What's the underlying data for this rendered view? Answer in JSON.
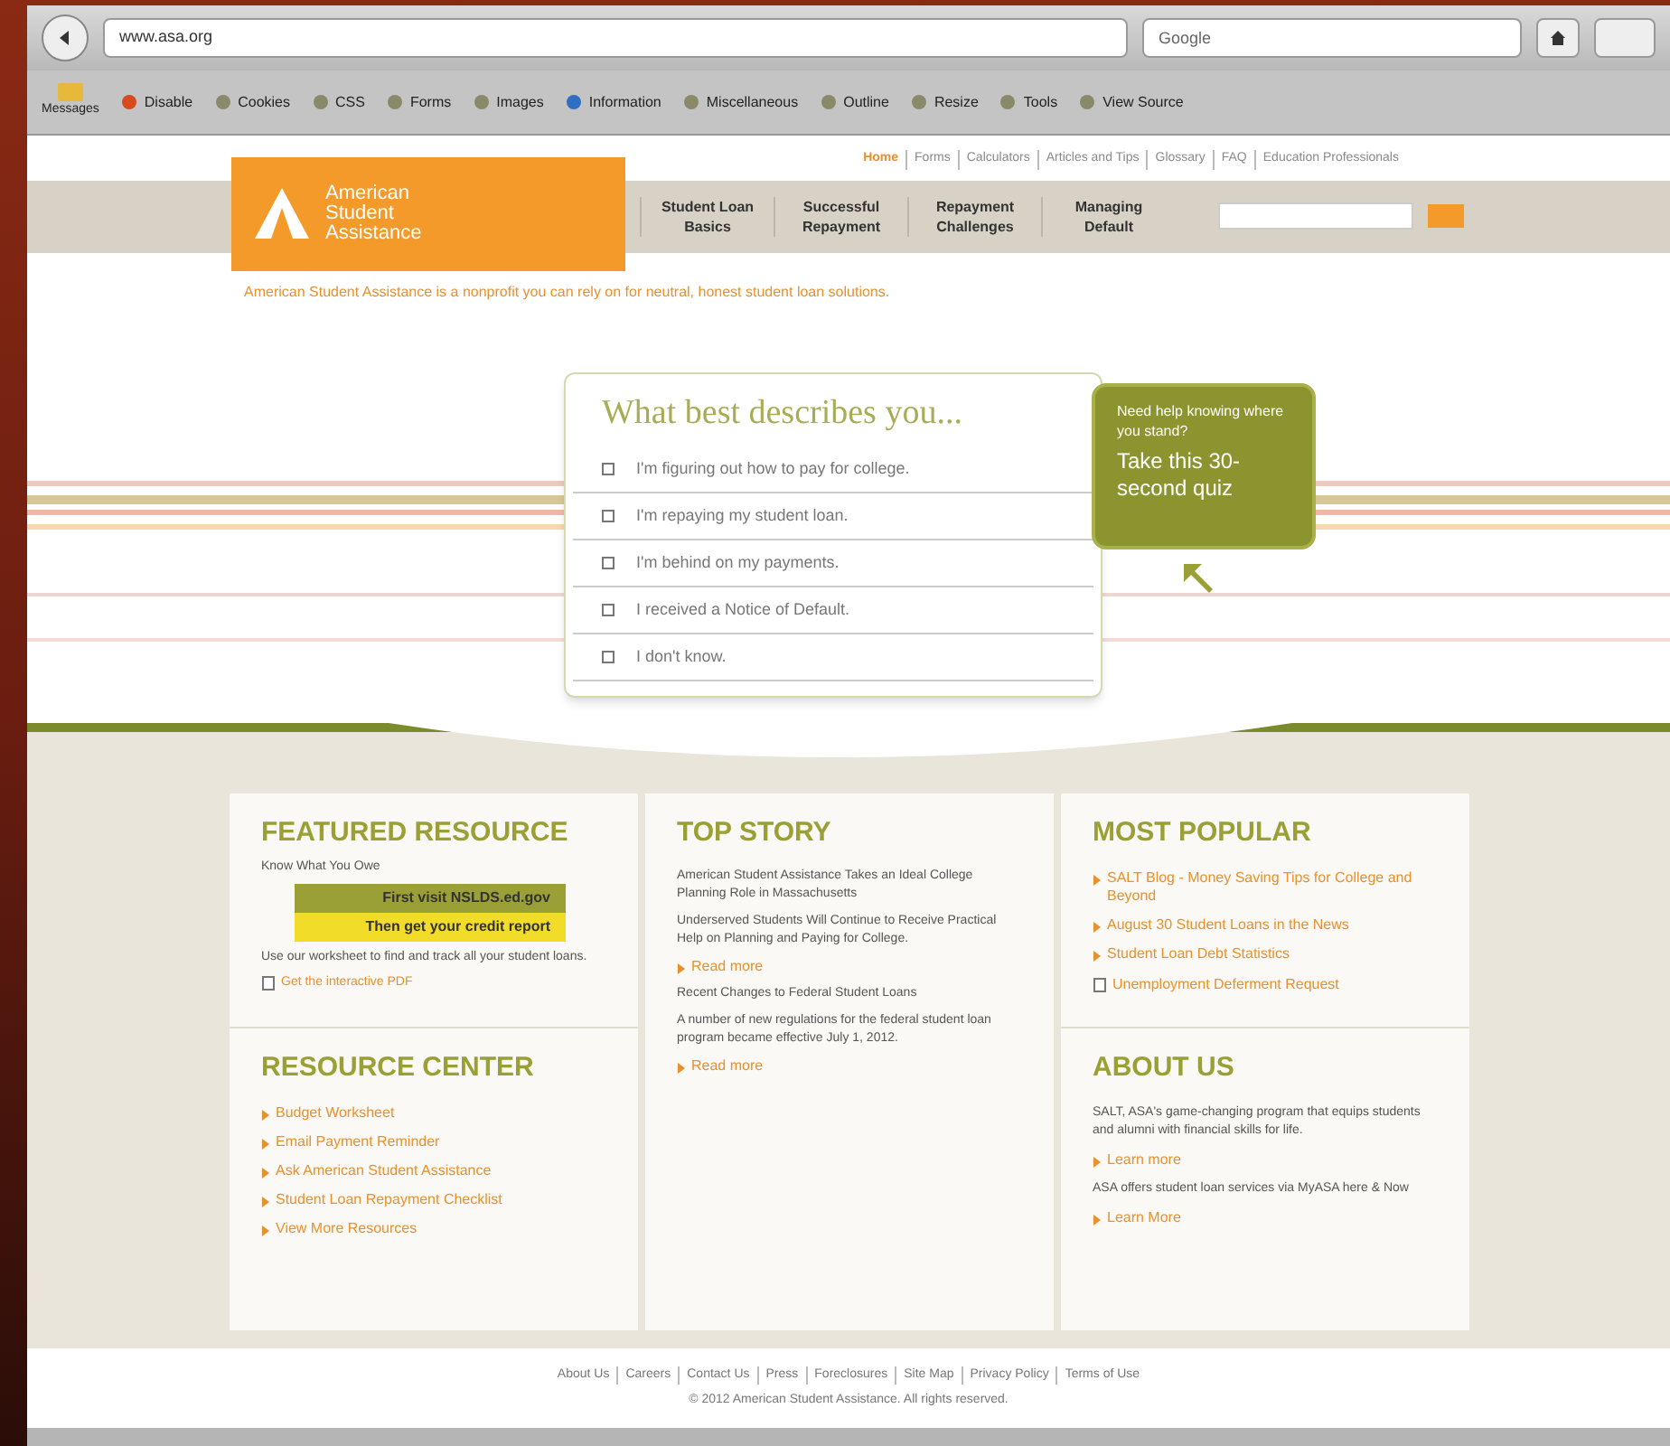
{
  "browser": {
    "url": "www.asa.org",
    "search_placeholder": "Google"
  },
  "bookmarks": [
    {
      "label": "Disable"
    },
    {
      "label": "Cookies"
    },
    {
      "label": "CSS"
    },
    {
      "label": "Forms"
    },
    {
      "label": "Images"
    },
    {
      "label": "Information"
    },
    {
      "label": "Miscellaneous"
    },
    {
      "label": "Outline"
    },
    {
      "label": "Resize"
    },
    {
      "label": "Tools"
    },
    {
      "label": "View Source"
    }
  ],
  "bookmarks_left": "Messages",
  "top_links": [
    {
      "label": "Home",
      "selected": true
    },
    {
      "label": "Forms",
      "selected": false
    },
    {
      "label": "Calculators",
      "selected": false
    },
    {
      "label": "Articles and Tips",
      "selected": false
    },
    {
      "label": "Glossary",
      "selected": false
    },
    {
      "label": "FAQ",
      "selected": false
    },
    {
      "label": "Education Professionals",
      "selected": false
    }
  ],
  "logo": {
    "name": "American Student Assistance"
  },
  "nav": [
    "Student Loan Basics",
    "Successful Repayment",
    "Repayment Challenges",
    "Managing Default"
  ],
  "tagline": "American Student Assistance is a nonprofit you can rely on for neutral, honest student loan solutions.",
  "quiz": {
    "title": "What best describes you...",
    "options": [
      {
        "label": "I'm figuring out how to pay for college.",
        "checked": false
      },
      {
        "label": "I'm repaying my student loan.",
        "checked": false
      },
      {
        "label": "I'm behind on my payments.",
        "checked": false
      },
      {
        "label": "I received a Notice of Default.",
        "checked": false
      },
      {
        "label": "I don't know.",
        "checked": false
      }
    ],
    "callout": {
      "question": "Need help knowing where you stand?",
      "action": "Take this 30-second quiz"
    }
  },
  "featured": {
    "title": "FEATURED RESOURCE",
    "subtitle": "Know What You Owe",
    "banner_top": "First visit NSLDS.ed.gov",
    "banner_bottom": "Then get your credit report",
    "text": "Use our worksheet to find and track all your student loans.",
    "link": "Get the interactive PDF"
  },
  "resource_center": {
    "title": "RESOURCE CENTER",
    "links": [
      "Budget Worksheet",
      "Email Payment Reminder",
      "Ask American Student Assistance",
      "Student Loan Repayment Checklist",
      "View More Resources"
    ]
  },
  "top_story": {
    "title": "TOP STORY",
    "stories": [
      {
        "headline": "American Student Assistance Takes an Ideal College Planning Role in Massachusetts",
        "summary": "Underserved Students Will Continue to Receive Practical Help on Planning and Paying for College.",
        "link": "Read more"
      },
      {
        "headline": "Recent Changes to Federal Student Loans",
        "summary": "A number of new regulations for the federal student loan program became effective July 1, 2012.",
        "link": "Read more"
      }
    ]
  },
  "most_popular": {
    "title": "MOST POPULAR",
    "links": [
      {
        "label": "SALT Blog - Money Saving Tips for College and Beyond",
        "kind": "link"
      },
      {
        "label": "August 30 Student Loans in the News",
        "kind": "link"
      },
      {
        "label": "Student Loan Debt Statistics",
        "kind": "link"
      },
      {
        "label": "Unemployment Deferment Request",
        "kind": "document"
      }
    ]
  },
  "about": {
    "title": "ABOUT US",
    "items": [
      {
        "text": "SALT, ASA's game-changing program that equips students and alumni with financial skills for life.",
        "link": "Learn more"
      },
      {
        "text": "ASA offers student loan services via MyASA here & Now",
        "link": "Learn More"
      }
    ]
  },
  "footer": {
    "links": [
      "About Us",
      "Careers",
      "Contact Us",
      "Press",
      "Foreclosures",
      "Site Map",
      "Privacy Policy",
      "Terms of Use"
    ],
    "copyright": "© 2012 American Student Assistance. All rights reserved."
  }
}
